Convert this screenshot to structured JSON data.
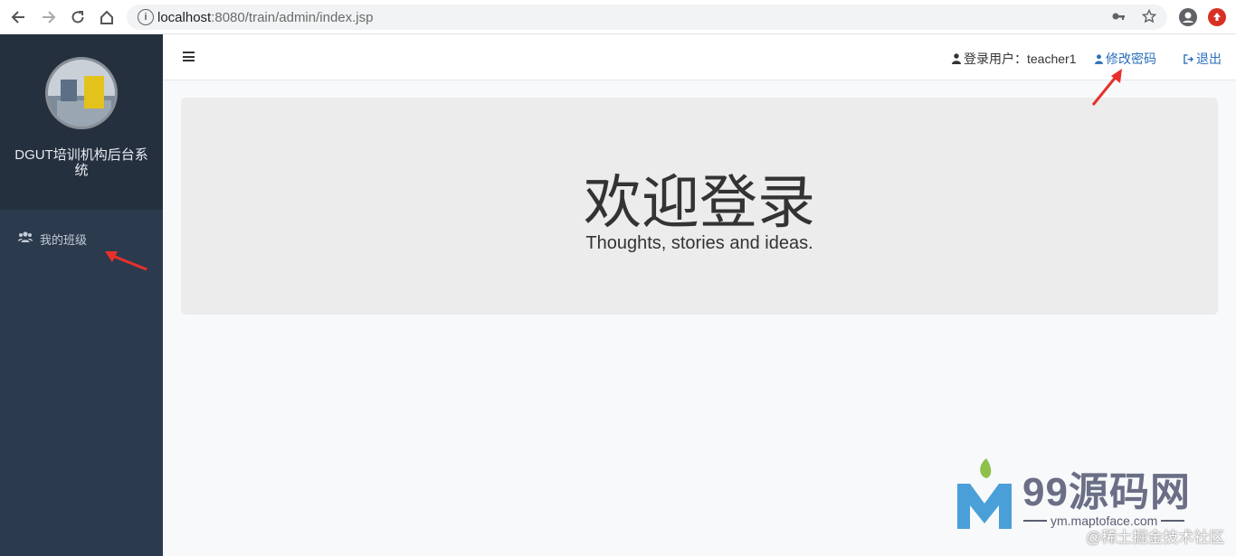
{
  "browser": {
    "url_host": "localhost",
    "url_rest": ":8080/train/admin/index.jsp",
    "icons": [
      "back-icon",
      "forward-icon",
      "reload-icon",
      "home-icon",
      "info-icon",
      "key-icon",
      "star-icon",
      "account-icon",
      "extension-icon"
    ]
  },
  "sidebar": {
    "title": "DGUT培训机构后台系统",
    "items": [
      {
        "label": "我的班级",
        "icon": "users-icon"
      }
    ]
  },
  "header": {
    "user_label": "登录用户：teacher1",
    "change_password": "修改密码",
    "logout": "退出"
  },
  "main": {
    "welcome": "欢迎登录",
    "tagline": "Thoughts, stories and ideas."
  },
  "watermark": {
    "brand": "99源码网",
    "url": "ym.maptoface.com",
    "juejin": "@稀土掘金技术社区"
  },
  "colors": {
    "sidebar": "#2c3a4e",
    "sidebar_top": "#25303f",
    "link": "#2a6ebb",
    "jumbotron": "#ececec",
    "annotation_arrow": "#e8302a"
  }
}
